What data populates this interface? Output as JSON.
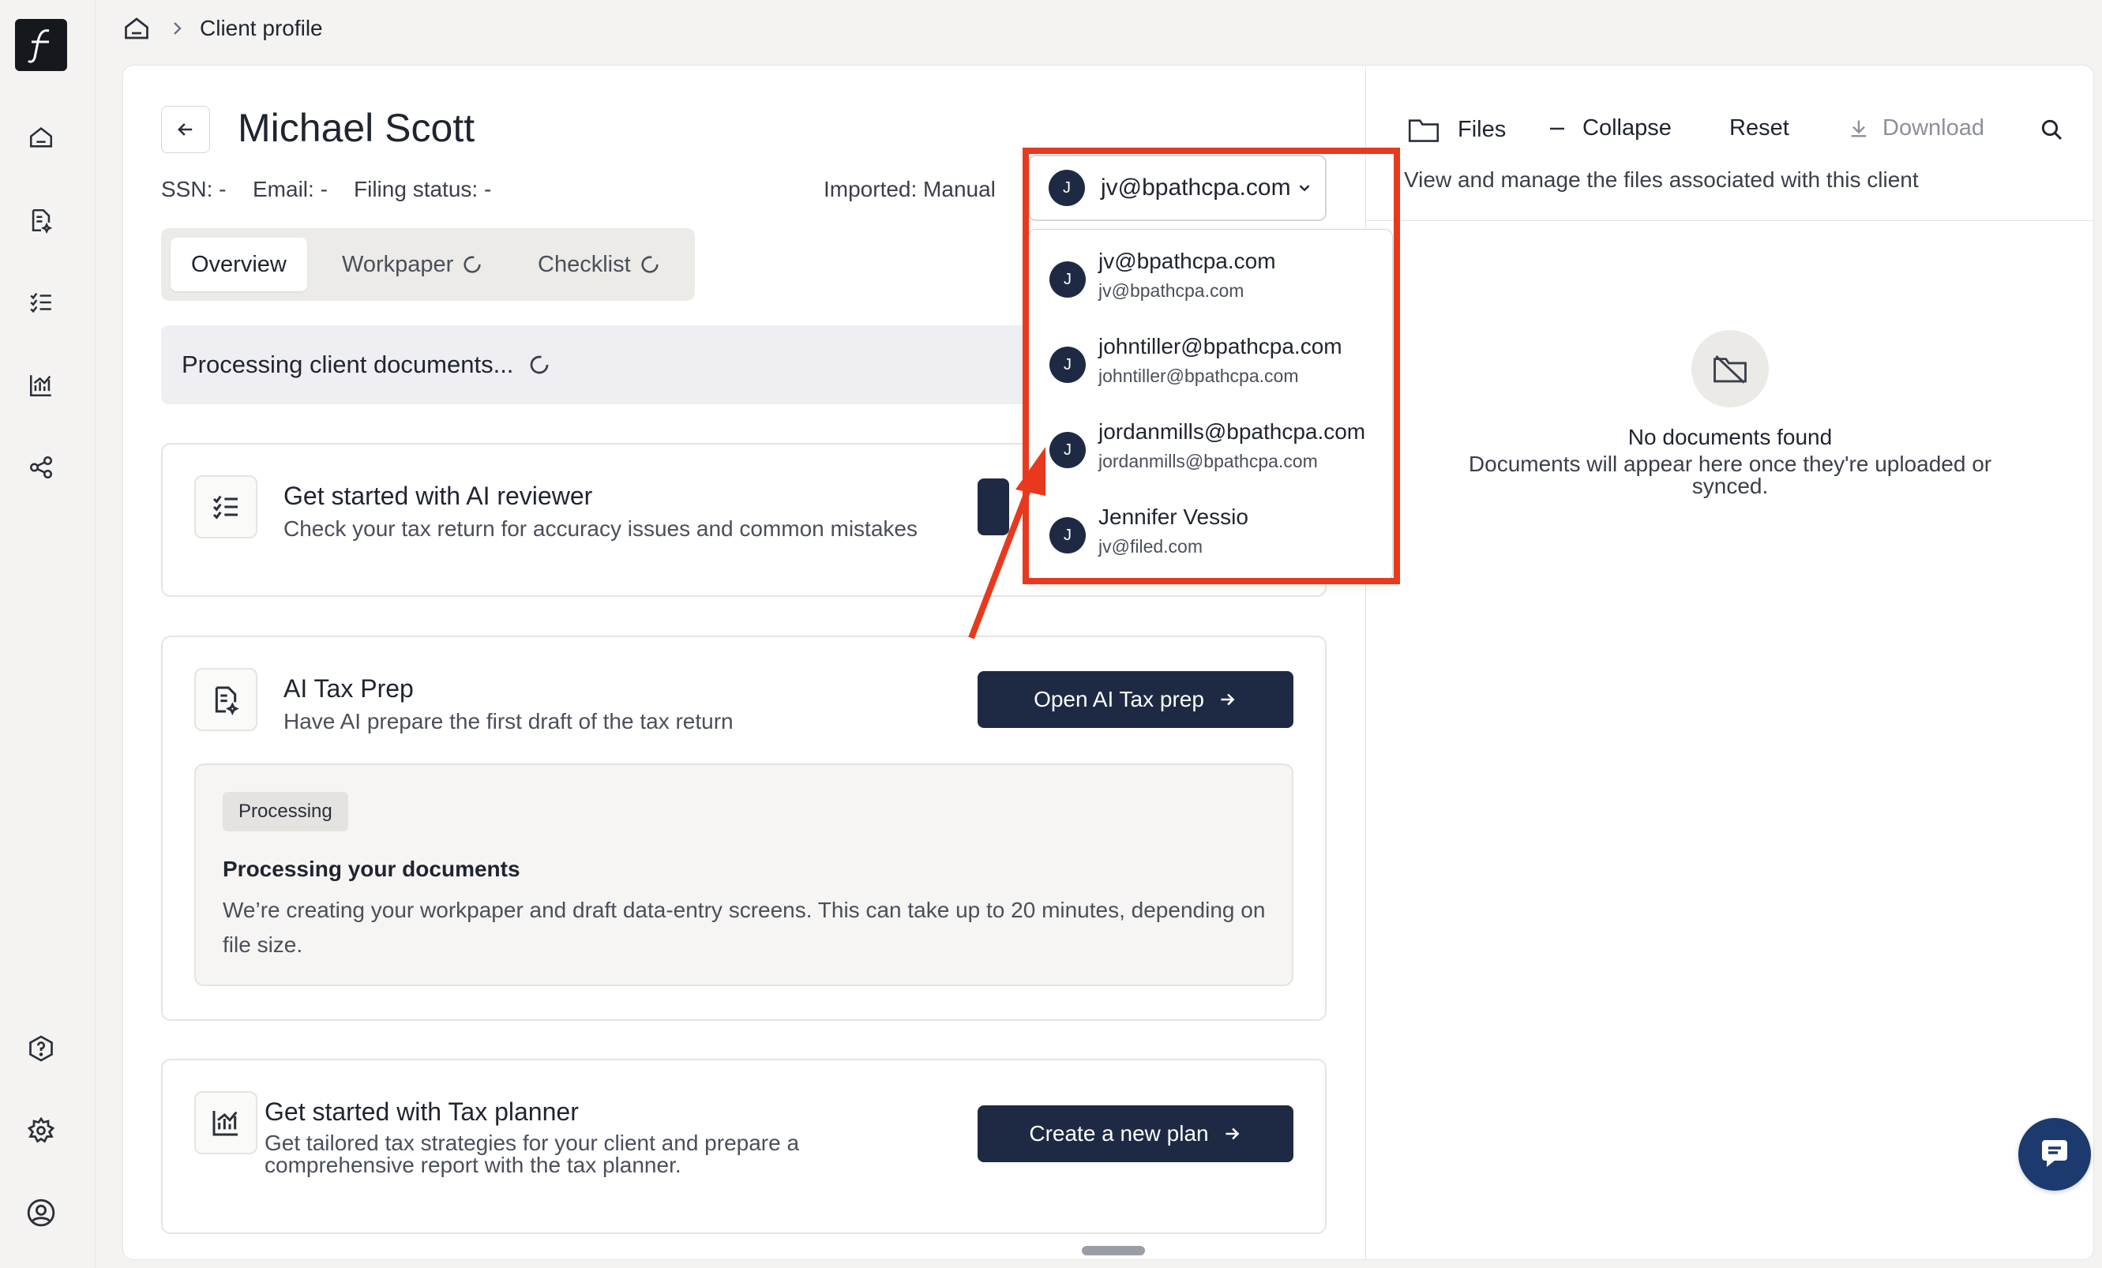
{
  "breadcrumb": {
    "current": "Client profile"
  },
  "client": {
    "name": "Michael Scott",
    "ssn": "SSN: -",
    "email": "Email: -",
    "filing_status": "Filing status: -",
    "imported": "Imported: Manual"
  },
  "owner_select": {
    "avatar": "J",
    "value": "jv@bpathcpa.com"
  },
  "tabs": [
    {
      "label": "Overview",
      "active": true
    },
    {
      "label": "Workpaper",
      "loading": true
    },
    {
      "label": "Checklist",
      "loading": true
    }
  ],
  "processing_banner": "Processing client documents...",
  "cards": {
    "ai_reviewer": {
      "title": "Get started with AI reviewer",
      "desc": "Check your tax return for accuracy issues and common mistakes"
    },
    "ai_tax_prep": {
      "title": "AI Tax Prep",
      "desc": "Have AI prepare the first draft of the tax return",
      "button": "Open AI Tax prep",
      "status_badge": "Processing",
      "status_title": "Processing your documents",
      "status_desc": "We’re creating your workpaper and draft data-entry screens. This can take up to 20 minutes, depending on file size."
    },
    "tax_planner": {
      "title": "Get started with Tax planner",
      "desc": "Get tailored tax strategies for your client and prepare a comprehensive report with the tax planner.",
      "button": "Create a new plan"
    }
  },
  "dropdown": {
    "items": [
      {
        "avatar": "J",
        "name": "jv@bpathcpa.com",
        "email": "jv@bpathcpa.com"
      },
      {
        "avatar": "J",
        "name": "johntiller@bpathcpa.com",
        "email": "johntiller@bpathcpa.com"
      },
      {
        "avatar": "J",
        "name": "jordanmills@bpathcpa.com",
        "email": "jordanmills@bpathcpa.com"
      },
      {
        "avatar": "J",
        "name": "Jennifer Vessio",
        "email": "jv@filed.com"
      }
    ]
  },
  "files_panel": {
    "files_label": "Files",
    "collapse_label": "Collapse",
    "reset_label": "Reset",
    "download_label": "Download",
    "subtitle": "View and manage the files associated with this client",
    "empty_title": "No documents found",
    "empty_desc": "Documents will appear here once they're uploaded or synced."
  },
  "colors": {
    "primary": "#1e2a44",
    "highlight": "#e8391e",
    "chat_fab": "#1c3a6e"
  }
}
